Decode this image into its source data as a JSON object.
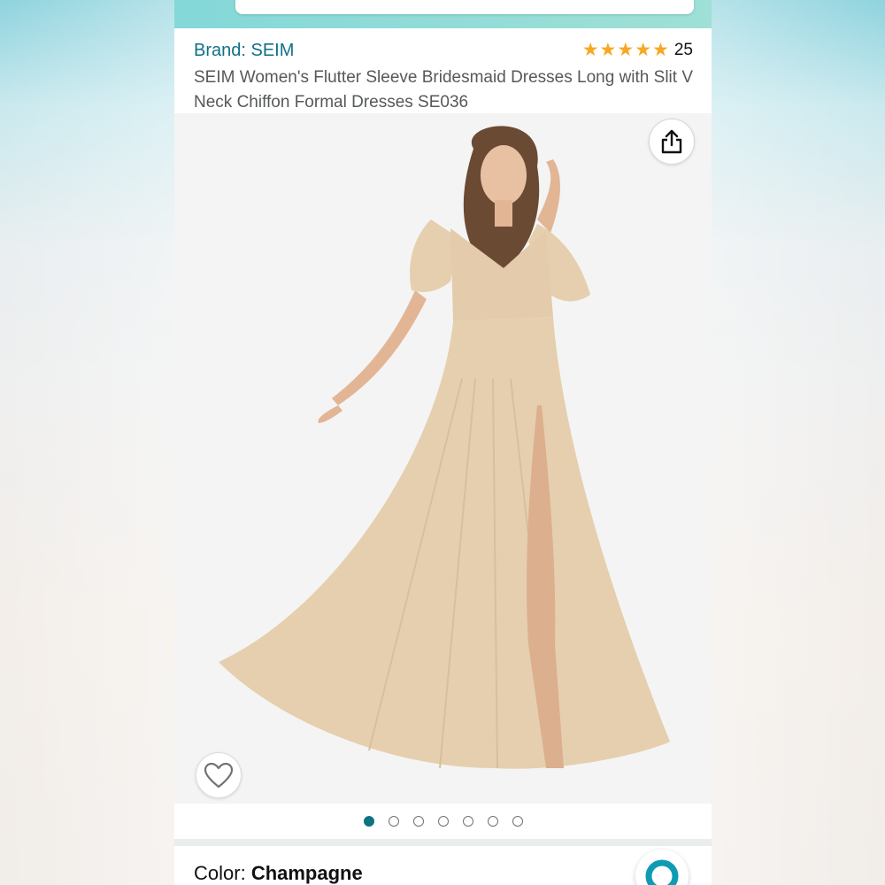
{
  "product": {
    "brand_label": "Brand: SEIM",
    "rating": {
      "stars": 5,
      "count": "25"
    },
    "title": "SEIM Women's Flutter Sleeve Bridesmaid Dresses Long with Slit V Neck Chiffon Formal Dresses SE036"
  },
  "gallery": {
    "image_count": 7,
    "active_index": 0,
    "share_icon": "share-icon",
    "wishlist_icon": "heart-icon"
  },
  "variation": {
    "color_label": "Color:",
    "color_value": "Champagne"
  },
  "colors": {
    "link": "#0f7184",
    "star": "#f6a823",
    "accent": "#0f7184",
    "dress": "#e6cfae"
  }
}
